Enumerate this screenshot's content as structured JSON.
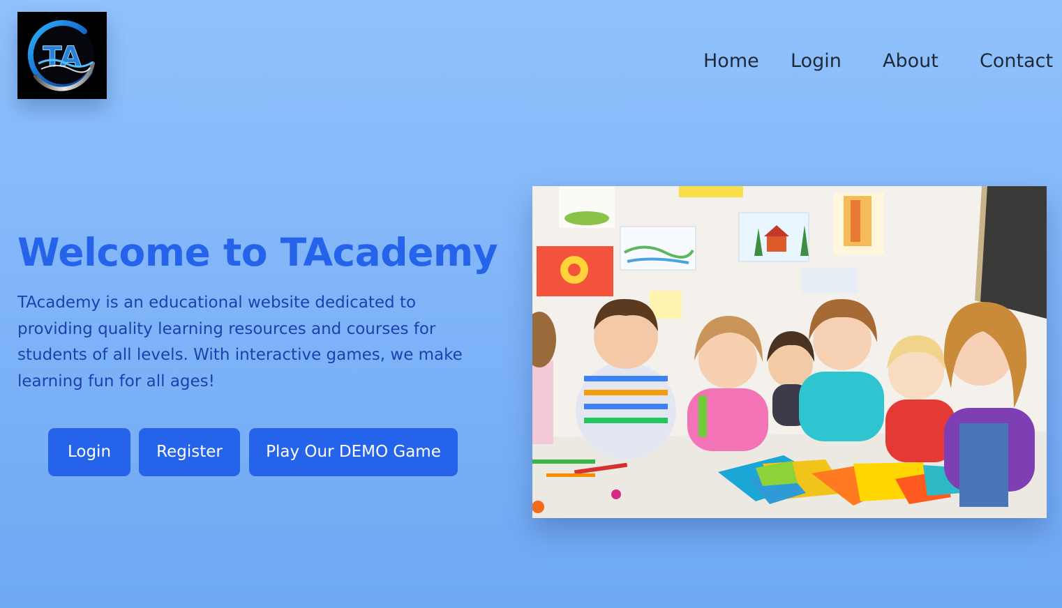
{
  "brand": {
    "logo_text": "TA",
    "logo_icon": "ta-logo-icon"
  },
  "nav": {
    "items": [
      {
        "label": "Home"
      },
      {
        "label": "Login"
      },
      {
        "label": "About"
      },
      {
        "label": "Contact"
      }
    ]
  },
  "hero": {
    "title": "Welcome to TAcademy",
    "description": "TAcademy is an educational website dedicated to providing quality learning resources and courses for students of all levels. With interactive games, we make learning fun for all ages!",
    "buttons": {
      "login": "Login",
      "register": "Register",
      "demo": "Play Our DEMO Game"
    },
    "image_icon": "children-classroom-photo"
  },
  "colors": {
    "accent": "#2563eb",
    "description_text": "#1e40af",
    "nav_text": "#1f2937",
    "background_top": "#90c2fc",
    "background_bottom": "#6fa8f4"
  }
}
